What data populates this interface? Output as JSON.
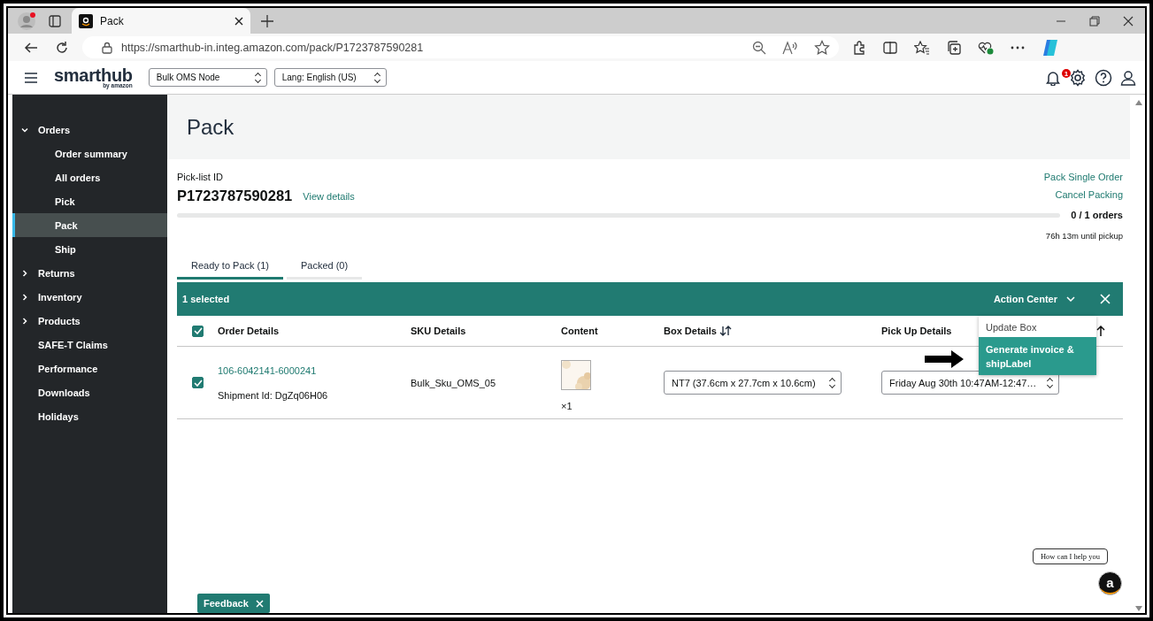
{
  "browser": {
    "tab_title": "Pack",
    "url": "https://smarthub-in.integ.amazon.com/pack/P1723787590281"
  },
  "header": {
    "logo": "smarthub",
    "logo_sub": "by amazon",
    "node_select": "Bulk OMS Node",
    "lang_select": "Lang: English (US)",
    "notification_count": "1"
  },
  "sidebar": {
    "items": [
      {
        "label": "Orders",
        "expanded": true,
        "selected": false,
        "children": [
          {
            "label": "Order summary",
            "selected": false
          },
          {
            "label": "All orders",
            "selected": false
          },
          {
            "label": "Pick",
            "selected": false
          },
          {
            "label": "Pack",
            "selected": true
          },
          {
            "label": "Ship",
            "selected": false
          }
        ]
      },
      {
        "label": "Returns",
        "expanded": false,
        "selected": false
      },
      {
        "label": "Inventory",
        "expanded": false,
        "selected": false
      },
      {
        "label": "Products",
        "expanded": false,
        "selected": false
      },
      {
        "label": "SAFE-T Claims",
        "selected": false
      },
      {
        "label": "Performance",
        "selected": false
      },
      {
        "label": "Downloads",
        "selected": false
      },
      {
        "label": "Holidays",
        "selected": false
      }
    ]
  },
  "page": {
    "title": "Pack",
    "picklist_label": "Pick-list ID",
    "picklist_id": "P1723787590281",
    "view_details": "View details",
    "actions": [
      "Pack Single Order",
      "Cancel Packing"
    ],
    "progress": {
      "level": 0,
      "reading": "0 / 1 orders"
    },
    "pickup_timer": "76h 13m until pickup"
  },
  "tabs": [
    {
      "label": "Ready to Pack (1)",
      "selected": true
    },
    {
      "label": "Packed (0)",
      "selected": false
    }
  ],
  "selection_bar": {
    "count": "1 selected",
    "action_center": "Action Center"
  },
  "action_menu": [
    {
      "label": "Update Box",
      "selected": false
    },
    {
      "label": "Generate invoice & shipLabel",
      "selected": true
    }
  ],
  "table": {
    "select_all": true,
    "columns": [
      {
        "label": "Order Details",
        "sortable": false
      },
      {
        "label": "SKU Details",
        "sortable": false
      },
      {
        "label": "Content",
        "sortable": false
      },
      {
        "label": "Box Details",
        "sortable": true
      },
      {
        "label": "Pick Up Details",
        "sortable": false
      }
    ],
    "rows": [
      {
        "checked": true,
        "order_id": "106-6042141-6000241",
        "shipment": "Shipment Id: DgZq06H06",
        "sku": "Bulk_Sku_OMS_05",
        "quantity": "×1",
        "box": "NT7 (37.6cm x 27.7cm x 10.6cm)",
        "pickup": "Friday Aug 30th 10:47AM-12:47…"
      }
    ]
  },
  "feedback": "Feedback",
  "chat": {
    "bubble": "How can I help you",
    "logo": "a"
  }
}
